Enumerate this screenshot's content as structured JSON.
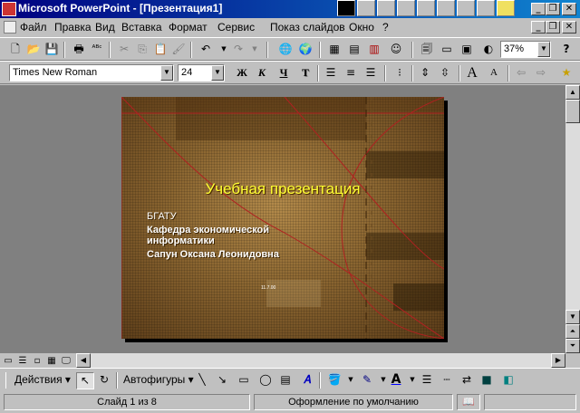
{
  "window": {
    "title": "Microsoft PowerPoint - [Презентация1]",
    "controls": {
      "minimize": "_",
      "restore": "❐",
      "close": "✕"
    },
    "doc_controls": {
      "minimize": "_",
      "restore": "❐",
      "close": "✕"
    }
  },
  "menu": {
    "items": [
      "Файл",
      "Правка",
      "Вид",
      "Вставка",
      "Формат",
      "Сервис",
      "Показ слайдов",
      "Окно",
      "?"
    ]
  },
  "standard_toolbar": {
    "zoom": "37%",
    "icons": [
      "new-icon",
      "open-icon",
      "save-icon",
      "print-icon",
      "spelling-icon",
      "cut-icon",
      "copy-icon",
      "paste-icon",
      "format-painter-icon",
      "undo-icon",
      "redo-icon",
      "hyperlink-icon",
      "web-toolbar-icon",
      "insert-table-icon",
      "insert-word-table-icon",
      "insert-chart-icon",
      "insert-clipart-icon",
      "new-slide-icon",
      "slide-layout-icon",
      "background-icon",
      "grayscale-icon",
      "help-icon"
    ]
  },
  "formatting_toolbar": {
    "font": "Times New Roman",
    "size": "24",
    "bold": "Ж",
    "italic": "К",
    "underline": "Ч",
    "shadow": "Т",
    "grow_font": "A",
    "shrink_font": "A"
  },
  "slide": {
    "title": "Учебная презентация",
    "lines": [
      "БГАТУ",
      "Кафедра экономической",
      "информатики",
      "Сапун Оксана Леонидовна"
    ],
    "date_text": "11.7.00"
  },
  "drawing_toolbar": {
    "actions": "Действия",
    "autoshapes": "Автофигуры",
    "font_color_letter": "A"
  },
  "status": {
    "slide": "Слайд 1 из 8",
    "design": "Оформление по умолчанию"
  },
  "colors": {
    "titlebar": "#000080",
    "slide_title": "#ffff33",
    "workspace": "#808080"
  }
}
